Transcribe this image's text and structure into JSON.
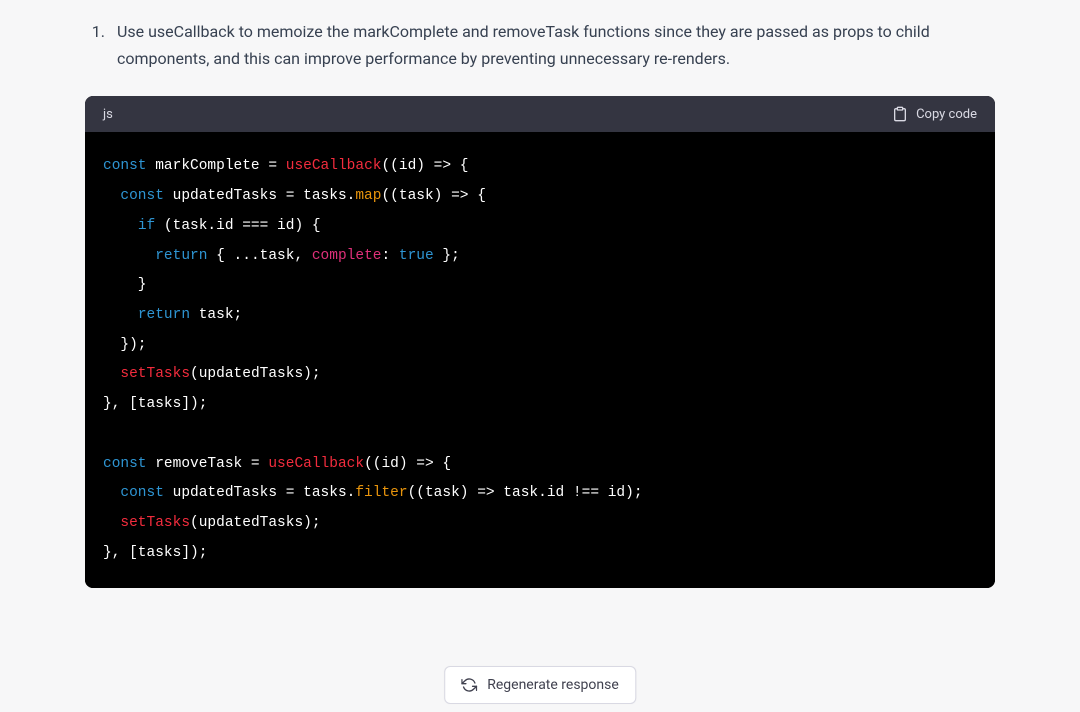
{
  "list": {
    "number": "1.",
    "text": "Use useCallback to memoize the markComplete and removeTask functions since they are passed as props to child components, and this can improve performance by preventing unnecessary re-renders."
  },
  "codeblock": {
    "language": "js",
    "copy_label": "Copy code",
    "tokens": [
      [
        {
          "t": "const",
          "c": "keyword"
        },
        {
          "t": " markComplete = ",
          "c": "plain"
        },
        {
          "t": "useCallback",
          "c": "func"
        },
        {
          "t": "(",
          "c": "plain"
        },
        {
          "t": "(id) =>",
          "c": "plain"
        },
        {
          "t": " {",
          "c": "plain"
        }
      ],
      [
        {
          "t": "  ",
          "c": "plain"
        },
        {
          "t": "const",
          "c": "keyword"
        },
        {
          "t": " updatedTasks = tasks.",
          "c": "plain"
        },
        {
          "t": "map",
          "c": "method"
        },
        {
          "t": "(",
          "c": "plain"
        },
        {
          "t": "(task) =>",
          "c": "plain"
        },
        {
          "t": " {",
          "c": "plain"
        }
      ],
      [
        {
          "t": "    ",
          "c": "plain"
        },
        {
          "t": "if",
          "c": "keyword"
        },
        {
          "t": " (task.id === id) {",
          "c": "plain"
        }
      ],
      [
        {
          "t": "      ",
          "c": "plain"
        },
        {
          "t": "return",
          "c": "keyword"
        },
        {
          "t": " { ...task, ",
          "c": "plain"
        },
        {
          "t": "complete",
          "c": "prop"
        },
        {
          "t": ": ",
          "c": "plain"
        },
        {
          "t": "true",
          "c": "bool"
        },
        {
          "t": " };",
          "c": "plain"
        }
      ],
      [
        {
          "t": "    }",
          "c": "plain"
        }
      ],
      [
        {
          "t": "    ",
          "c": "plain"
        },
        {
          "t": "return",
          "c": "keyword"
        },
        {
          "t": " task;",
          "c": "plain"
        }
      ],
      [
        {
          "t": "  });",
          "c": "plain"
        }
      ],
      [
        {
          "t": "  ",
          "c": "plain"
        },
        {
          "t": "setTasks",
          "c": "func"
        },
        {
          "t": "(updatedTasks);",
          "c": "plain"
        }
      ],
      [
        {
          "t": "}, [tasks]);",
          "c": "plain"
        }
      ],
      [
        {
          "t": "",
          "c": "plain"
        }
      ],
      [
        {
          "t": "const",
          "c": "keyword"
        },
        {
          "t": " removeTask = ",
          "c": "plain"
        },
        {
          "t": "useCallback",
          "c": "func"
        },
        {
          "t": "(",
          "c": "plain"
        },
        {
          "t": "(id) =>",
          "c": "plain"
        },
        {
          "t": " {",
          "c": "plain"
        }
      ],
      [
        {
          "t": "  ",
          "c": "plain"
        },
        {
          "t": "const",
          "c": "keyword"
        },
        {
          "t": " updatedTasks = tasks.",
          "c": "plain"
        },
        {
          "t": "filter",
          "c": "method"
        },
        {
          "t": "(",
          "c": "plain"
        },
        {
          "t": "(task) =>",
          "c": "plain"
        },
        {
          "t": " task.id !== id);",
          "c": "plain"
        }
      ],
      [
        {
          "t": "  ",
          "c": "plain"
        },
        {
          "t": "setTasks",
          "c": "func"
        },
        {
          "t": "(updatedTasks);",
          "c": "plain"
        }
      ],
      [
        {
          "t": "}, [tasks]);",
          "c": "plain"
        }
      ]
    ]
  },
  "regenerate_label": "Regenerate response"
}
